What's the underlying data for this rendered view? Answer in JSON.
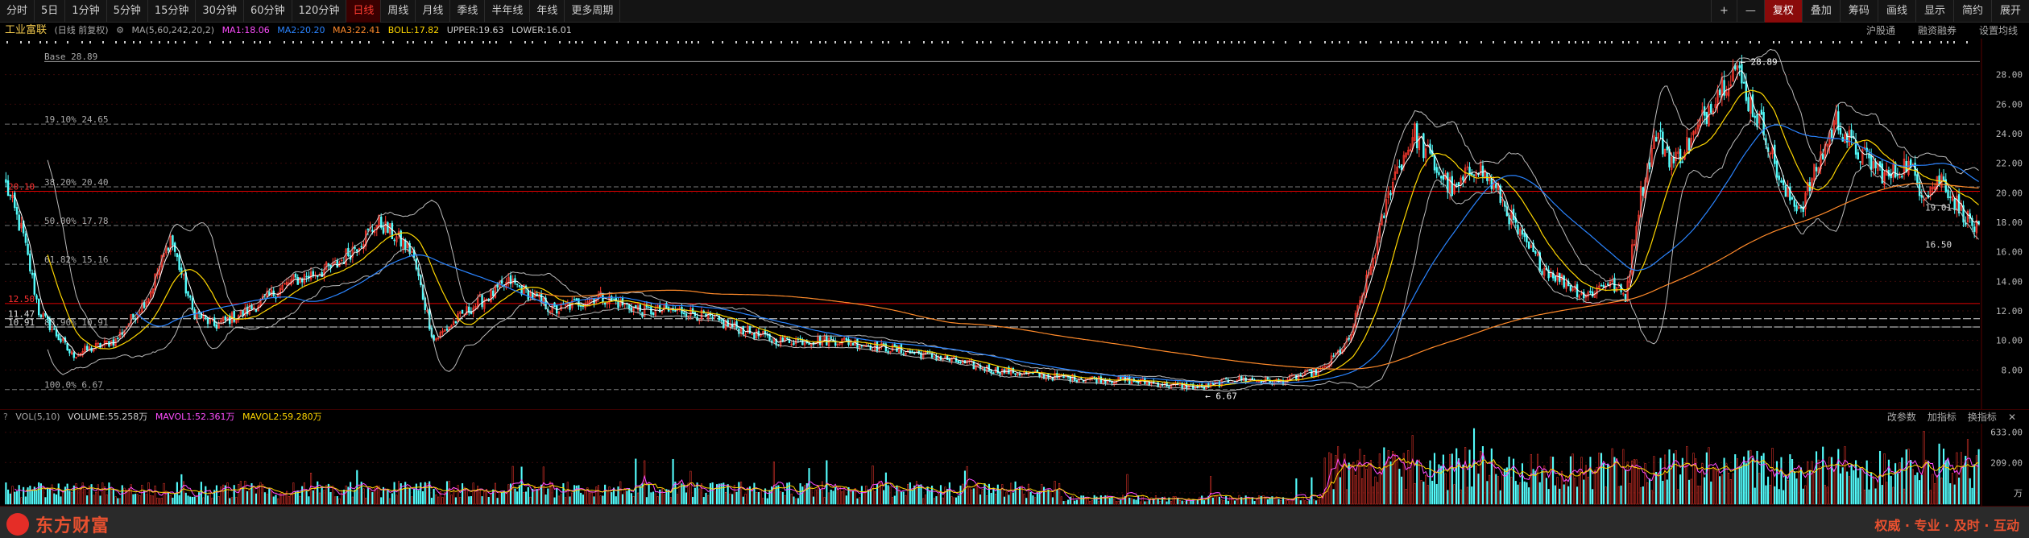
{
  "toolbar": {
    "timeframes": [
      "分时",
      "5日",
      "1分钟",
      "5分钟",
      "15分钟",
      "30分钟",
      "60分钟",
      "120分钟",
      "日线",
      "周线",
      "月线",
      "季线",
      "半年线",
      "年线",
      "更多周期"
    ],
    "active_timeframe": "日线",
    "right_buttons": [
      "+",
      "—",
      "复权",
      "叠加",
      "筹码",
      "画线",
      "显示",
      "简约",
      "展开"
    ],
    "selected_right": "复权"
  },
  "infobar": {
    "stock_name": "工业富联",
    "period_label": "(日线 前复权)",
    "ma_label": "MA(5,60,242,20,2)",
    "ma1": "MA1:18.06",
    "ma2": "MA2:20.20",
    "ma3": "MA3:22.41",
    "boll": "BOLL:17.82",
    "upper": "UPPER:19.63",
    "lower": "LOWER:16.01",
    "links": [
      "沪股通",
      "融资融券",
      "设置均线"
    ]
  },
  "colors": {
    "up": "#ff3b30",
    "down": "#54ffff",
    "ma1": "#ffffff",
    "ma2": "#2a84ff",
    "ma3": "#ff8a2a",
    "boll": "#ffd700",
    "volma1": "#ff4dff",
    "volma2": "#ffd700"
  },
  "chart_data": {
    "type": "candlestick",
    "yticks": [
      "28.00",
      "26.00",
      "24.00",
      "22.00",
      "20.00",
      "18.00",
      "16.00",
      "14.00",
      "12.00",
      "10.00",
      "8.00"
    ],
    "ylim": [
      6,
      30
    ],
    "base_label": "Base  28.89",
    "high_label": "28.89",
    "low_label": "6.67",
    "fib_levels": [
      {
        "label": "19.10% 24.65",
        "value": 24.65
      },
      {
        "label": "38.20% 20.40",
        "value": 20.4
      },
      {
        "label": "50.00% 17.78",
        "value": 17.78
      },
      {
        "label": "61.82% 15.16",
        "value": 15.16
      },
      {
        "label": "80.90% 10.91",
        "value": 10.91
      },
      {
        "label": "100.0% 6.67",
        "value": 6.67
      }
    ],
    "left_markers": [
      {
        "label": "20.10",
        "value": 20.1
      },
      {
        "label": "12.50",
        "value": 12.5
      },
      {
        "label": "11.47",
        "value": 11.47
      },
      {
        "label": "10.91",
        "value": 10.91
      }
    ],
    "right_markers": [
      {
        "label": "19.01",
        "value": 19.01
      },
      {
        "label": "16.50",
        "value": 16.5
      }
    ],
    "price_anchors": [
      [
        0,
        20.5
      ],
      [
        8,
        17
      ],
      [
        15,
        12
      ],
      [
        30,
        9
      ],
      [
        50,
        10
      ],
      [
        65,
        13
      ],
      [
        75,
        17
      ],
      [
        85,
        12
      ],
      [
        95,
        11
      ],
      [
        110,
        12
      ],
      [
        130,
        14
      ],
      [
        150,
        15
      ],
      [
        170,
        18
      ],
      [
        185,
        16
      ],
      [
        195,
        10
      ],
      [
        210,
        12
      ],
      [
        230,
        14
      ],
      [
        250,
        12
      ],
      [
        270,
        13
      ],
      [
        290,
        12
      ],
      [
        310,
        12
      ],
      [
        330,
        11
      ],
      [
        350,
        10
      ],
      [
        380,
        10
      ],
      [
        420,
        9
      ],
      [
        450,
        8
      ],
      [
        480,
        7.5
      ],
      [
        510,
        7.3
      ],
      [
        530,
        7
      ],
      [
        545,
        6.8
      ],
      [
        560,
        7.4
      ],
      [
        580,
        7.2
      ],
      [
        600,
        8
      ],
      [
        612,
        10
      ],
      [
        622,
        15
      ],
      [
        632,
        21
      ],
      [
        642,
        24
      ],
      [
        650,
        22
      ],
      [
        660,
        20
      ],
      [
        670,
        22
      ],
      [
        680,
        20
      ],
      [
        690,
        17
      ],
      [
        700,
        15
      ],
      [
        710,
        14
      ],
      [
        720,
        13
      ],
      [
        730,
        14
      ],
      [
        738,
        13
      ],
      [
        745,
        20
      ],
      [
        752,
        24
      ],
      [
        760,
        22
      ],
      [
        770,
        24
      ],
      [
        780,
        27
      ],
      [
        788,
        28.5
      ],
      [
        795,
        26
      ],
      [
        802,
        24
      ],
      [
        810,
        20
      ],
      [
        818,
        19
      ],
      [
        826,
        22
      ],
      [
        834,
        25
      ],
      [
        842,
        23
      ],
      [
        850,
        22
      ],
      [
        858,
        21
      ],
      [
        866,
        22
      ],
      [
        874,
        20
      ],
      [
        882,
        21
      ],
      [
        890,
        19
      ],
      [
        898,
        17.5
      ]
    ],
    "ma_periods": [
      5,
      60,
      242,
      20
    ],
    "bar_count": 900
  },
  "volume": {
    "header_label": "VOL(5,10)",
    "volume": "VOLUME:55.258万",
    "mavol1": "MAVOL1:52.361万",
    "mavol2": "MAVOL2:59.280万",
    "right_links": [
      "改参数",
      "加指标",
      "换指标"
    ],
    "yticks": [
      "633.00",
      "209.00",
      "万"
    ]
  },
  "footer": {
    "brand": "东方财富",
    "slogan": "权威 · 专业 · 及时 · 互动"
  }
}
